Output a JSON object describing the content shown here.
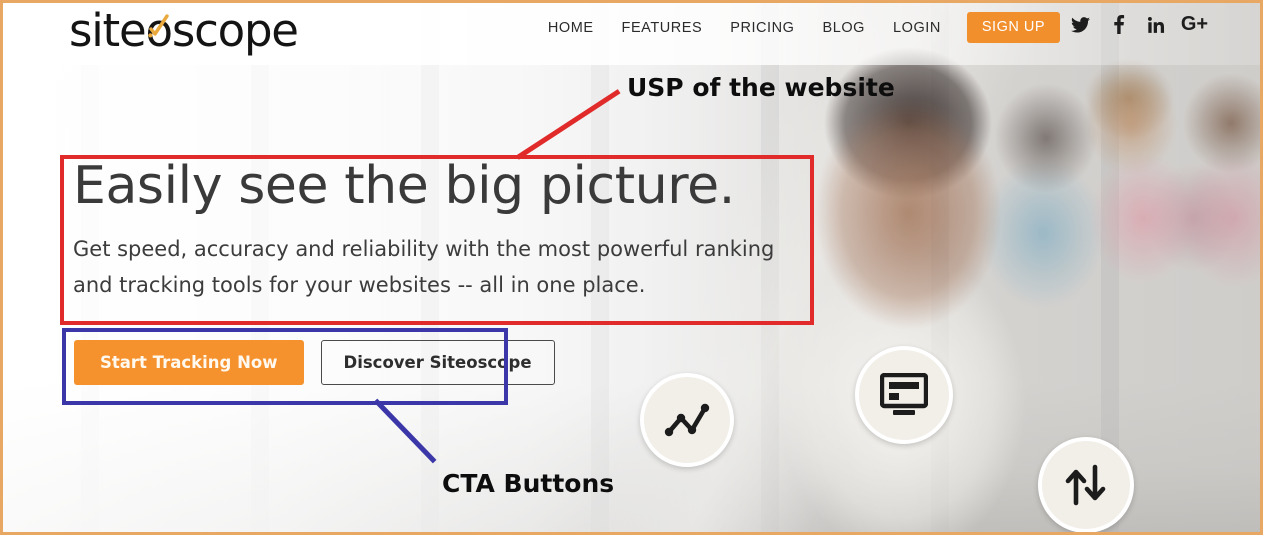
{
  "brand": {
    "logo_text_before": "site",
    "logo_text_o": "o",
    "logo_text_after": "scope",
    "logo_mark": "checkmark-spark-icon",
    "accent_orange": "#f18f2c",
    "frame_border_color": "#e8a763"
  },
  "nav": {
    "links": [
      {
        "label": "HOME",
        "name": "nav-link-home"
      },
      {
        "label": "FEATURES",
        "name": "nav-link-features"
      },
      {
        "label": "PRICING",
        "name": "nav-link-pricing"
      },
      {
        "label": "BLOG",
        "name": "nav-link-blog"
      },
      {
        "label": "LOGIN",
        "name": "nav-link-login"
      }
    ],
    "signup_label": "SIGN UP",
    "social": [
      {
        "icon": "twitter-icon",
        "glyph": ""
      },
      {
        "icon": "facebook-icon",
        "glyph": "f"
      },
      {
        "icon": "linkedin-icon",
        "glyph": "in"
      },
      {
        "icon": "googleplus-icon",
        "glyph": "G+"
      }
    ]
  },
  "hero": {
    "headline": "Easily see the big picture.",
    "subhead": "Get speed, accuracy and reliability with the most powerful ranking and tracking tools for your websites -- all in one place.",
    "cta_primary": "Start Tracking Now",
    "cta_secondary": "Discover Siteoscope"
  },
  "badges": [
    {
      "icon": "line-chart-icon",
      "name": "feature-badge-analytics"
    },
    {
      "icon": "monitor-screen-icon",
      "name": "feature-badge-monitoring"
    },
    {
      "icon": "up-down-arrows-icon",
      "name": "feature-badge-rank-change"
    }
  ],
  "annotations": {
    "usp_label": "USP of the website",
    "usp_color": "#e12b2b",
    "cta_label": "CTA Buttons",
    "cta_color": "#3b37a8"
  }
}
